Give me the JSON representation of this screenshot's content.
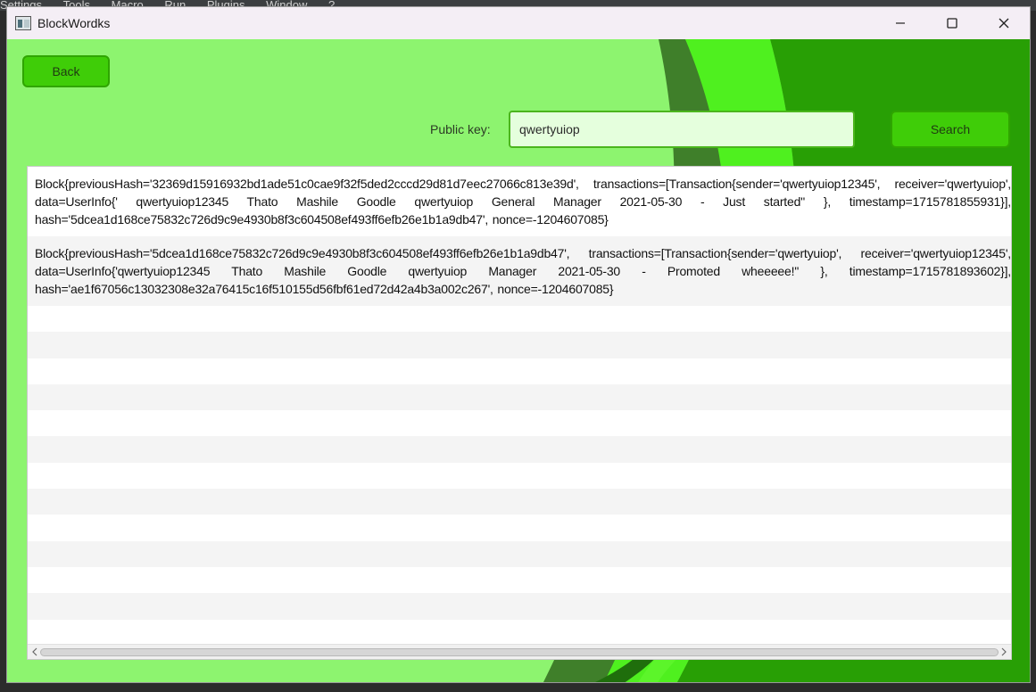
{
  "background_app": {
    "menu_items": [
      "Settings",
      "Tools",
      "Macro",
      "Run",
      "Plugins",
      "Window",
      "?"
    ]
  },
  "window": {
    "title": "BlockWordks",
    "icons": [
      "app-icon",
      "minimize-icon",
      "maximize-icon",
      "close-icon"
    ]
  },
  "colors": {
    "background": "#8df46f",
    "accent_dark": "#2a9e00",
    "accent_mid": "#45e51f",
    "button": "#3fcd08"
  },
  "toolbar": {
    "back_label": "Back",
    "search_label": "Search"
  },
  "search": {
    "label": "Public key:",
    "value": "qwertyuiop"
  },
  "blocks": [
    "Block{previousHash='32369d15916932bd1ade51c0cae9f32f5ded2cccd29d81d7eec27066c813e39d', transactions=[Transaction{sender='qwertyuiop12345', receiver='qwertyuiop', data=UserInfo{' qwertyuiop12345 Thato Mashile Goodle qwertyuiop General Manager 2021-05-30 - Just started'' }, timestamp=1715781855931}], hash='5dcea1d168ce75832c726d9c9e4930b8f3c604508ef493ff6efb26e1b1a9db47', nonce=-1204607085}",
    "Block{previousHash='5dcea1d168ce75832c726d9c9e4930b8f3c604508ef493ff6efb26e1b1a9db47', transactions=[Transaction{sender='qwertyuiop', receiver='qwertyuiop12345', data=UserInfo{'qwertyuiop12345 Thato Mashile Goodle qwertyuiop Manager 2021-05-30 - Promoted wheeeee!'' }, timestamp=1715781893602}], hash='ae1f67056c13032308e32a76415c16f510155d56fbf61ed72d42a4b3a002c267', nonce=-1204607085}"
  ]
}
